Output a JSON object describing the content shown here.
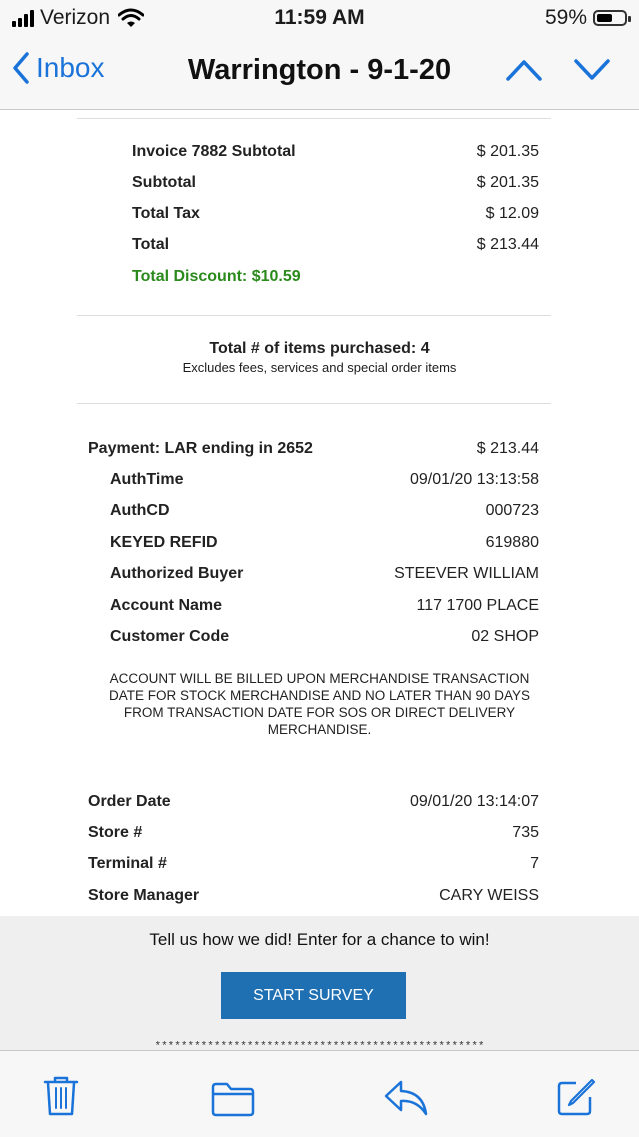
{
  "status_bar": {
    "carrier": "Verizon",
    "time": "11:59 AM",
    "battery": "59%",
    "battery_level": 0.59
  },
  "nav": {
    "back_label": "Inbox",
    "title": "Warrington - 9-1-20"
  },
  "totals": {
    "rows": [
      {
        "label": "Invoice 7882 Subtotal",
        "value": "$ 201.35"
      },
      {
        "label": "Subtotal",
        "value": "$ 201.35"
      },
      {
        "label": "Total Tax",
        "value": "$ 12.09"
      },
      {
        "label": "Total",
        "value": "$ 213.44"
      }
    ],
    "discount": "Total Discount: $10.59"
  },
  "items": {
    "count_line": "Total # of items purchased: 4",
    "note": "Excludes fees, services and special order items"
  },
  "payment": {
    "label": "Payment: LAR ending in 2652",
    "amount": "$ 213.44",
    "details": [
      {
        "label": "AuthTime",
        "value": "09/01/20 13:13:58"
      },
      {
        "label": "AuthCD",
        "value": "000723"
      },
      {
        "label": "KEYED REFID",
        "value": "619880"
      },
      {
        "label": "Authorized Buyer",
        "value": "STEEVER WILLIAM"
      },
      {
        "label": "Account Name",
        "value": "117 1700 PLACE"
      },
      {
        "label": "Customer Code",
        "value": "02 SHOP"
      }
    ],
    "billing_note_lines": [
      "ACCOUNT WILL BE BILLED UPON MERCHANDISE TRANSACTION",
      "DATE FOR STOCK MERCHANDISE AND NO LATER THAN 90 DAYS",
      "FROM TRANSACTION DATE FOR SOS OR DIRECT DELIVERY",
      "MERCHANDISE."
    ]
  },
  "order": {
    "rows": [
      {
        "label": "Order Date",
        "value": "09/01/20 13:14:07"
      },
      {
        "label": "Store #",
        "value": "735"
      },
      {
        "label": "Terminal #",
        "value": "7"
      },
      {
        "label": "Store Manager",
        "value": "CARY WEISS"
      }
    ]
  },
  "survey": {
    "message": "Tell us how we did! Enter for a chance to win!",
    "button": "START SURVEY",
    "stars": "**************************************************"
  },
  "toolbar": {
    "icons": [
      "trash-icon",
      "folder-icon",
      "reply-icon",
      "compose-icon"
    ]
  },
  "colors": {
    "accent": "#1a73d9",
    "discount": "#2b8a1c",
    "survey_button": "#1f6fb3"
  }
}
